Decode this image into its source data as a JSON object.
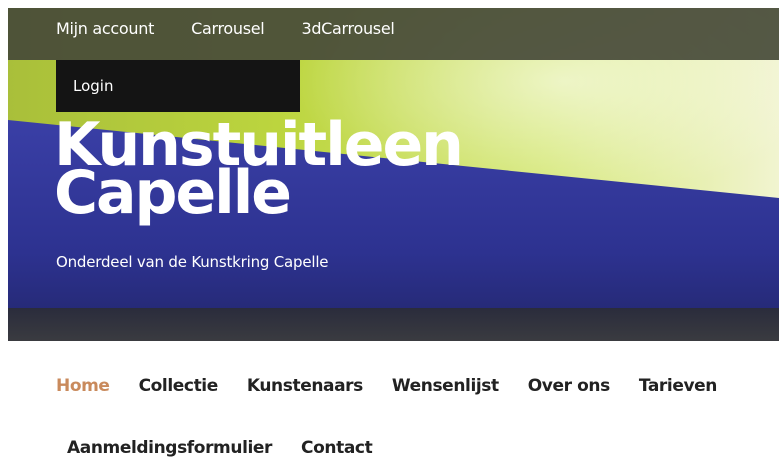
{
  "top_menu": {
    "items": [
      "Mijn account",
      "Carrousel",
      "3dCarrousel"
    ],
    "login_label": "Login"
  },
  "hero": {
    "site_title_line1": "Kunstuitleen",
    "site_title_line2": "Capelle",
    "tagline": "Onderdeel van de Kunstkring Capelle"
  },
  "main_menu": {
    "row1": [
      "Home",
      "Collectie",
      "Kunstenaars",
      "Wensenlijst",
      "Over ons",
      "Tarieven"
    ],
    "row2": [
      "Aanmeldingsformulier",
      "Contact"
    ],
    "active_item": "Home"
  },
  "colors": {
    "accent_active": "#c98a5c",
    "nav_text": "#222222",
    "hero_blue": "#2c2f80",
    "hero_green": "#c8e04a",
    "top_bar": "#464a38",
    "login_bg": "#141414"
  }
}
